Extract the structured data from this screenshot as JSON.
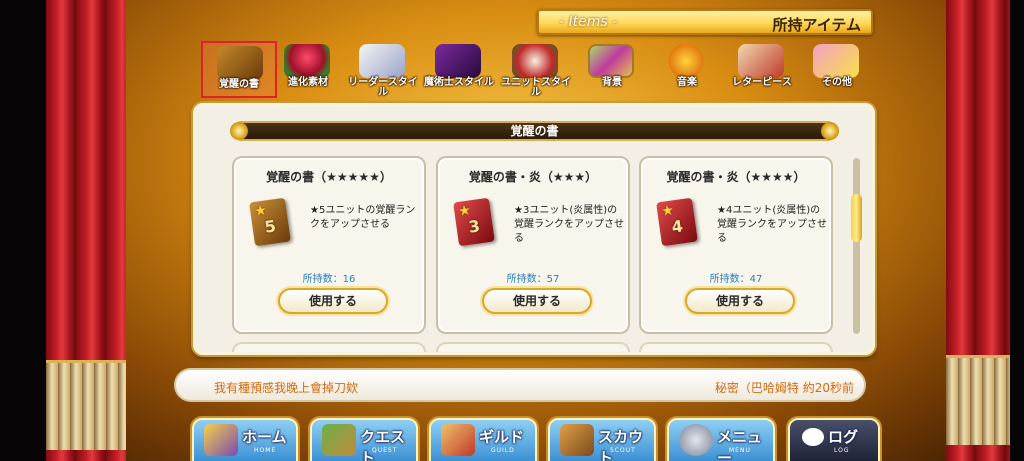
{
  "header": {
    "title_en": "- Items -",
    "title_jp": "所持アイテム"
  },
  "tabs": [
    {
      "label": "覚醒の書",
      "icon": "awakening-book-icon",
      "active": true
    },
    {
      "label": "進化素材",
      "icon": "flower-icon",
      "active": false
    },
    {
      "label": "リーダースタイル",
      "icon": "leader-style-icon",
      "active": false
    },
    {
      "label": "魔術士スタイル",
      "icon": "mage-style-icon",
      "active": false
    },
    {
      "label": "ユニットスタイル",
      "icon": "unit-style-icon",
      "active": false
    },
    {
      "label": "背景",
      "icon": "background-icon",
      "active": false
    },
    {
      "label": "音楽",
      "icon": "music-note-icon",
      "active": false
    },
    {
      "label": "レターピース",
      "icon": "letter-piece-icon",
      "active": false
    },
    {
      "label": "その他",
      "icon": "misc-icon",
      "active": false
    }
  ],
  "section": {
    "title": "覚醒の書"
  },
  "cards": [
    {
      "name": "覚醒の書（★★★★★）",
      "desc": "★5ユニットの覚醒ランクをアップさせる",
      "owned": "所持数：16",
      "use_label": "使用する",
      "book_num": "5",
      "book_color": "#8a5a1a"
    },
    {
      "name": "覚醒の書・炎（★★★）",
      "desc": "★3ユニット(炎属性)の覚醒ランクをアップさせる",
      "owned": "所持数：57",
      "use_label": "使用する",
      "book_num": "3",
      "book_color": "#b0242c"
    },
    {
      "name": "覚醒の書・炎（★★★★）",
      "desc": "★4ユニット(炎属性)の覚醒ランクをアップさせる",
      "owned": "所持数：47",
      "use_label": "使用する",
      "book_num": "4",
      "book_color": "#b0242c"
    }
  ],
  "chat": {
    "message": "我有種預感我晚上會掉刀欸",
    "meta": "秘密（巴哈姆特 約20秒前"
  },
  "nav": [
    {
      "label": "ホーム",
      "sub": "HOME",
      "icon": "home-tent-icon"
    },
    {
      "label": "クエスト",
      "sub": "QUEST",
      "icon": "quest-map-icon"
    },
    {
      "label": "ギルド",
      "sub": "GUILD",
      "icon": "guild-castle-icon"
    },
    {
      "label": "スカウト",
      "sub": "SCOUT",
      "icon": "scout-board-icon"
    },
    {
      "label": "メニュー",
      "sub": "MENU",
      "icon": "gear-icon"
    },
    {
      "label": "ログ",
      "sub": "LOG",
      "icon": "chat-bubble-icon"
    }
  ],
  "colors": {
    "accent": "#d8a82a",
    "owned_text": "#2a7fc0",
    "chat_text": "#d46a10"
  }
}
